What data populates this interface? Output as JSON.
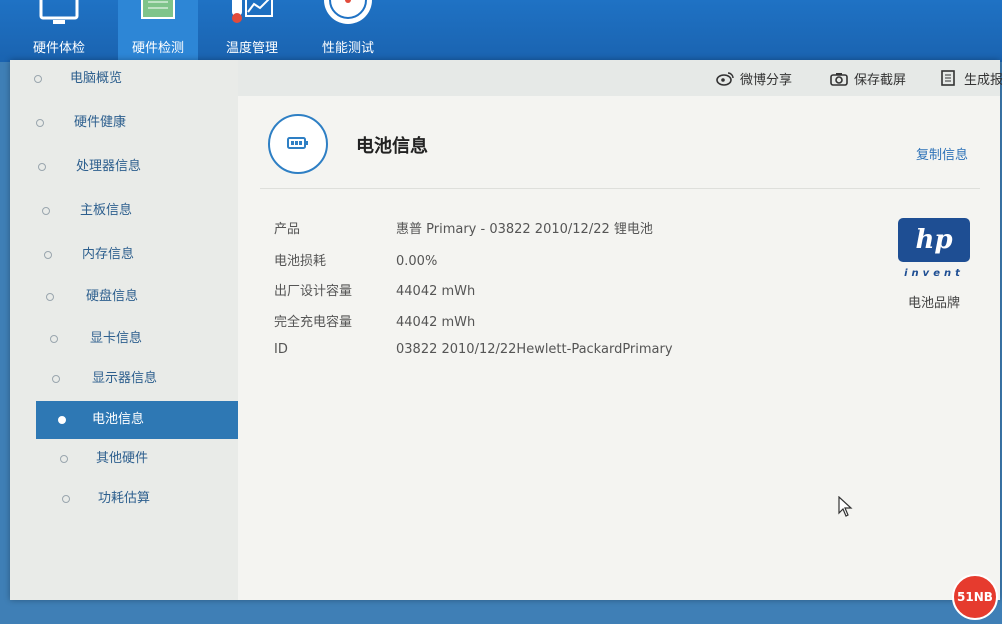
{
  "nav": {
    "items": [
      {
        "label": "硬件体检",
        "icon": "monitor-icon"
      },
      {
        "label": "硬件检测",
        "icon": "motherboard-icon"
      },
      {
        "label": "温度管理",
        "icon": "thermometer-icon"
      },
      {
        "label": "性能测试",
        "icon": "speedometer-icon"
      }
    ]
  },
  "sidebar": {
    "items": [
      {
        "label": "电脑概览"
      },
      {
        "label": "硬件健康"
      },
      {
        "label": "处理器信息"
      },
      {
        "label": "主板信息"
      },
      {
        "label": "内存信息"
      },
      {
        "label": "硬盘信息"
      },
      {
        "label": "显卡信息"
      },
      {
        "label": "显示器信息"
      },
      {
        "label": "电池信息"
      },
      {
        "label": "其他硬件"
      },
      {
        "label": "功耗估算"
      }
    ]
  },
  "toolbar": {
    "share": "微博分享",
    "screenshot": "保存截屏",
    "report": "生成报"
  },
  "main": {
    "title": "电池信息",
    "copy": "复制信息",
    "rows": [
      {
        "key": "产品",
        "value": "惠普 Primary - 03822 2010/12/22 锂电池"
      },
      {
        "key": "电池损耗",
        "value": "0.00%"
      },
      {
        "key": "出厂设计容量",
        "value": "44042 mWh"
      },
      {
        "key": "完全充电容量",
        "value": "44042 mWh"
      },
      {
        "key": "ID",
        "value": "03822 2010/12/22Hewlett-PackardPrimary"
      }
    ],
    "brand": {
      "logo_text": "hp",
      "logo_sub": "invent",
      "label": "电池品牌"
    }
  },
  "watermark": "51NB",
  "colors": {
    "accent": "#2e78b4",
    "nav_bg": "#1f72c4",
    "brand": "#1e4e93"
  }
}
